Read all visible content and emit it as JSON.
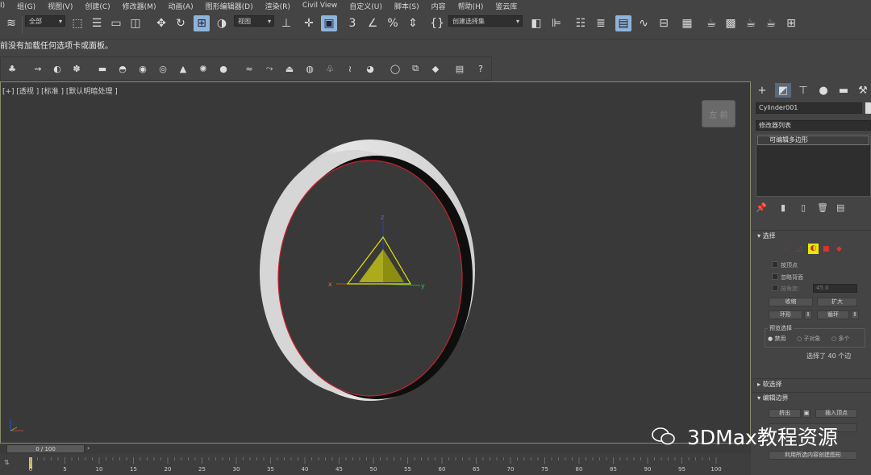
{
  "menu": [
    "I)",
    "组(G)",
    "视图(V)",
    "创建(C)",
    "修改器(M)",
    "动画(A)",
    "图形编辑器(D)",
    "渲染(R)",
    "Civil View",
    "自定义(U)",
    "脚本(S)",
    "内容",
    "帮助(H)",
    "鉴云库"
  ],
  "toolbar": {
    "selection_filter": "全部",
    "ref_coord": "视图",
    "named_selection": "创建选择集"
  },
  "status_message": "前没有加载任何选项卡或面板。",
  "viewport": {
    "label": "[+] [透视 ] [标准 ] [默认明暗处理 ]",
    "viewcube_label": "左 前",
    "gizmo_x": "x",
    "gizmo_y": "y",
    "gizmo_z": "z"
  },
  "command_panel": {
    "object_name": "Cylinder001",
    "modifier_list": "修改器列表",
    "stack_item": "可编辑多边形",
    "selection_rollout": "选择",
    "by_vertex": "按顶点",
    "ignore_backfacing": "忽略背面",
    "angle_label": "按角度:",
    "angle_value": "45.0",
    "shrink": "收缩",
    "grow": "扩大",
    "ring": "环形",
    "loop": "循环",
    "preview_selection": "预览选择",
    "preview_off": "禁用",
    "preview_subobj": "子对象",
    "preview_multi": "多个",
    "selected_count": "选择了 40 个边",
    "soft_selection": "软选择",
    "edit_edges": "编辑边界",
    "extrude": "挤出",
    "insert_vertex": "插入顶点",
    "create_shape": "利用所选内容创建图形"
  },
  "timeline": {
    "slider": "0 / 100",
    "ticks": [
      "0",
      "5",
      "10",
      "15",
      "20",
      "25",
      "30",
      "35",
      "40",
      "45",
      "50",
      "55",
      "60",
      "65",
      "70",
      "75",
      "80",
      "85",
      "90",
      "95",
      "100"
    ]
  },
  "watermark": "3DMax教程资源",
  "colors": {
    "viewport_bg": "#393939",
    "ring_face": "#d9d9d9",
    "edge_highlight": "#cc2030",
    "gizmo_yellow": "#e6e600",
    "active_button": "#8fb3d9"
  }
}
